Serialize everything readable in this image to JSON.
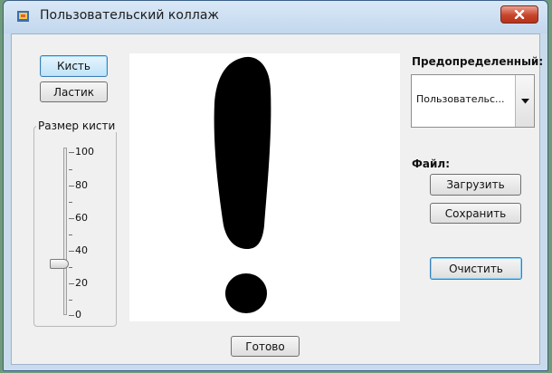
{
  "window": {
    "title": "Пользовательский коллаж"
  },
  "tools": {
    "brush_label": "Кисть",
    "eraser_label": "Ластик"
  },
  "brush_size": {
    "group_label": "Размер кисти",
    "min": 0,
    "max": 100,
    "value": 33,
    "tick_labels": [
      "100",
      "80",
      "60",
      "40",
      "20",
      "0"
    ]
  },
  "preset": {
    "label": "Предопределенный:",
    "selected": "Пользовательс..."
  },
  "file": {
    "label": "Файл:",
    "load_label": "Загрузить",
    "save_label": "Сохранить"
  },
  "actions": {
    "clear_label": "Очистить",
    "done_label": "Готово"
  },
  "colors": {
    "titlebar": "#c9dbec",
    "client": "#f0f0f0",
    "canvas": "#ffffff",
    "ink": "#000000",
    "close": "#c8452c"
  },
  "icons": {
    "app": "app-icon",
    "close": "close-icon",
    "combo": "chevron-down-icon"
  }
}
